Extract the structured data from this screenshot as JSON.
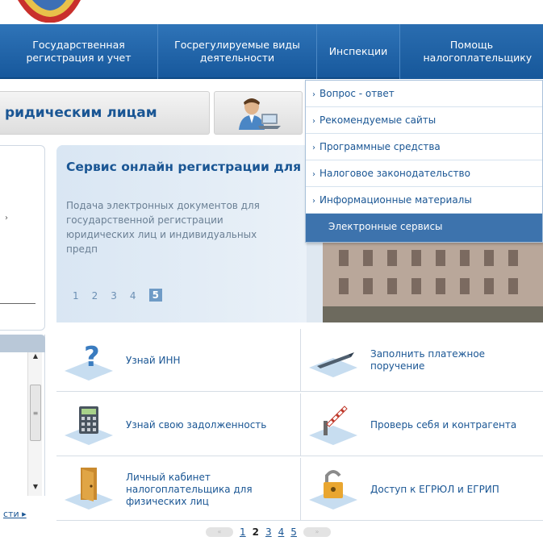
{
  "topnav": {
    "items": [
      {
        "label": "Государственная регистрация и учет"
      },
      {
        "label": "Госрегулируемые виды деятельности"
      },
      {
        "label": "Инспекции"
      },
      {
        "label": "Помощь налогоплательщику"
      }
    ]
  },
  "header": {
    "title": "ридическим лицам"
  },
  "dropdown": {
    "items": [
      {
        "label": "Вопрос - ответ"
      },
      {
        "label": "Рекомендуемые сайты"
      },
      {
        "label": "Программные средства"
      },
      {
        "label": "Налоговое законодательство"
      },
      {
        "label": "Информационные материалы"
      },
      {
        "label": "Электронные сервисы",
        "selected": true
      }
    ]
  },
  "slider": {
    "title": "Сервис онлайн регистрации для",
    "description": "Подача электронных документов для государственной регистрации юридических лиц и индивидуальных предп",
    "pages": [
      "1",
      "2",
      "3",
      "4",
      "5"
    ],
    "current_page": "5"
  },
  "services": [
    {
      "label": "Узнай ИНН",
      "icon": "question-icon"
    },
    {
      "label": "Заполнить платежное поручение",
      "icon": "pen-icon"
    },
    {
      "label": "Узнай свою задолженность",
      "icon": "calculator-icon"
    },
    {
      "label": "Проверь себя и контрагента",
      "icon": "barrier-icon"
    },
    {
      "label": "Личный кабинет налогоплательщика для физических лиц",
      "icon": "door-icon"
    },
    {
      "label": "Доступ к ЕГРЮЛ и ЕГРИП",
      "icon": "lock-icon"
    }
  ],
  "left": {
    "link": "сти"
  },
  "pager": {
    "pages": [
      "1",
      "2",
      "3",
      "4",
      "5"
    ],
    "current": "2"
  },
  "colors": {
    "nav_blue": "#1e64a8",
    "link_blue": "#1a5694",
    "selected_menu": "#3d73ad"
  }
}
